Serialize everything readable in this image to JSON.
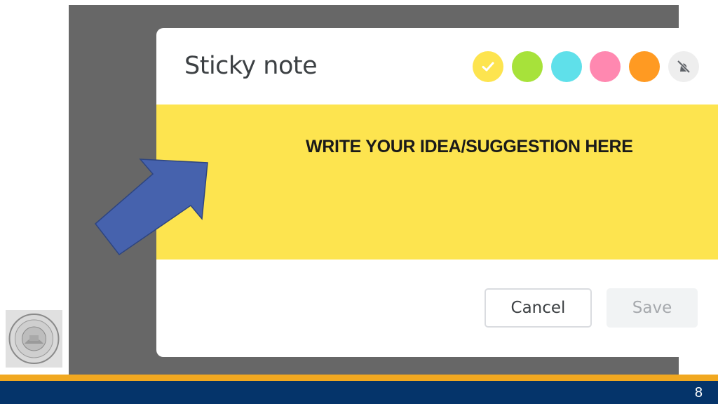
{
  "dialog": {
    "title": "Sticky note",
    "colors": [
      {
        "name": "yellow",
        "hex": "#fde44f",
        "selected": true,
        "icon": "check-icon"
      },
      {
        "name": "green",
        "hex": "#a7e23a",
        "selected": false
      },
      {
        "name": "cyan",
        "hex": "#5fe0ea",
        "selected": false
      },
      {
        "name": "pink",
        "hex": "#ff88b0",
        "selected": false
      },
      {
        "name": "orange",
        "hex": "#ff9a22",
        "selected": false
      },
      {
        "name": "no-color",
        "hex": "#eeeeee",
        "selected": false,
        "icon": "no-color-icon"
      }
    ],
    "note_text": "WRITE YOUR IDEA/SUGGESTION HERE",
    "cancel_label": "Cancel",
    "save_label": "Save"
  },
  "annotation": {
    "arrow_color": "#4662ad",
    "icon": "arrow-up-right-icon"
  },
  "slide": {
    "page_number": "8",
    "accent_color": "#f1a820",
    "footer_color": "#05346a",
    "seal_icon": "seal-icon"
  }
}
